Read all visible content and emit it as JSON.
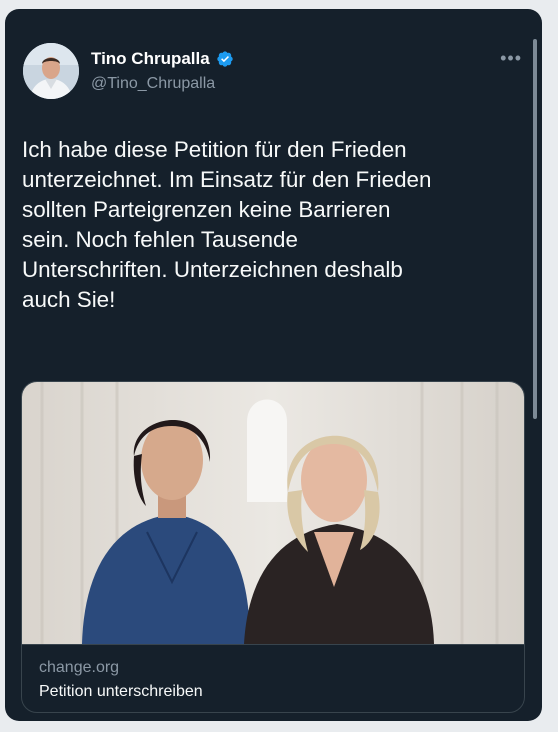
{
  "tweet": {
    "author_name": "Tino Chrupalla",
    "handle": "@Tino_Chrupalla",
    "lines": [
      "Ich habe diese Petition für den Frieden",
      "unterzeichnet. Im Einsatz für den Frieden",
      "sollten Parteigrenzen keine Barrieren",
      "sein. Noch fehlen Tausende",
      "Unterschriften. Unterzeichnen deshalb",
      "auch Sie!"
    ],
    "more_label": "•••"
  },
  "card": {
    "domain": "change.org",
    "title": "Petition unterschreiben"
  },
  "icons": {
    "verified": "verified-badge-icon",
    "more": "more-icon"
  },
  "colors": {
    "background": "#15202b",
    "text": "#f7f9f9",
    "secondary": "#8b98a5",
    "verified": "#1d9bf0",
    "border": "#38444d"
  }
}
